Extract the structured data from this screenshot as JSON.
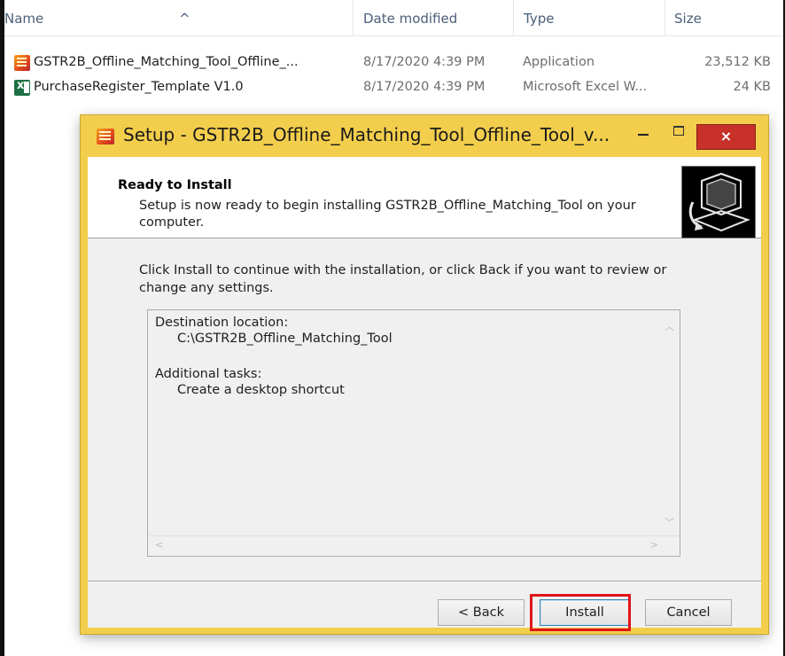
{
  "explorer": {
    "columns": {
      "name": "Name",
      "date_modified": "Date modified",
      "type": "Type",
      "size": "Size"
    },
    "files": [
      {
        "name": "GSTR2B_Offline_Matching_Tool_Offline_...",
        "date": "8/17/2020 4:39 PM",
        "type": "Application",
        "size": "23,512 KB",
        "icon": "application-icon"
      },
      {
        "name": "PurchaseRegister_Template V1.0",
        "date": "8/17/2020 4:39 PM",
        "type": "Microsoft Excel W...",
        "size": "24 KB",
        "icon": "excel-file-icon"
      }
    ]
  },
  "setup": {
    "title": "Setup - GSTR2B_Offline_Matching_Tool_Offline_Tool_v...",
    "window_controls": {
      "close": "×"
    },
    "header": {
      "title": "Ready to Install",
      "description": "Setup is now ready to begin installing GSTR2B_Offline_Matching_Tool on your computer."
    },
    "body_text": "Click Install to continue with the installation, or click Back if you want to review or change any settings.",
    "memo": {
      "destination_label": "Destination location:",
      "destination_value": "C:\\GSTR2B_Offline_Matching_Tool",
      "tasks_label": "Additional tasks:",
      "tasks_value": "Create a desktop shortcut"
    },
    "buttons": {
      "back": "< Back",
      "install": "Install",
      "cancel": "Cancel"
    },
    "highlight_color": "#e0151b",
    "title_bar_color": "#f3ce4c"
  }
}
